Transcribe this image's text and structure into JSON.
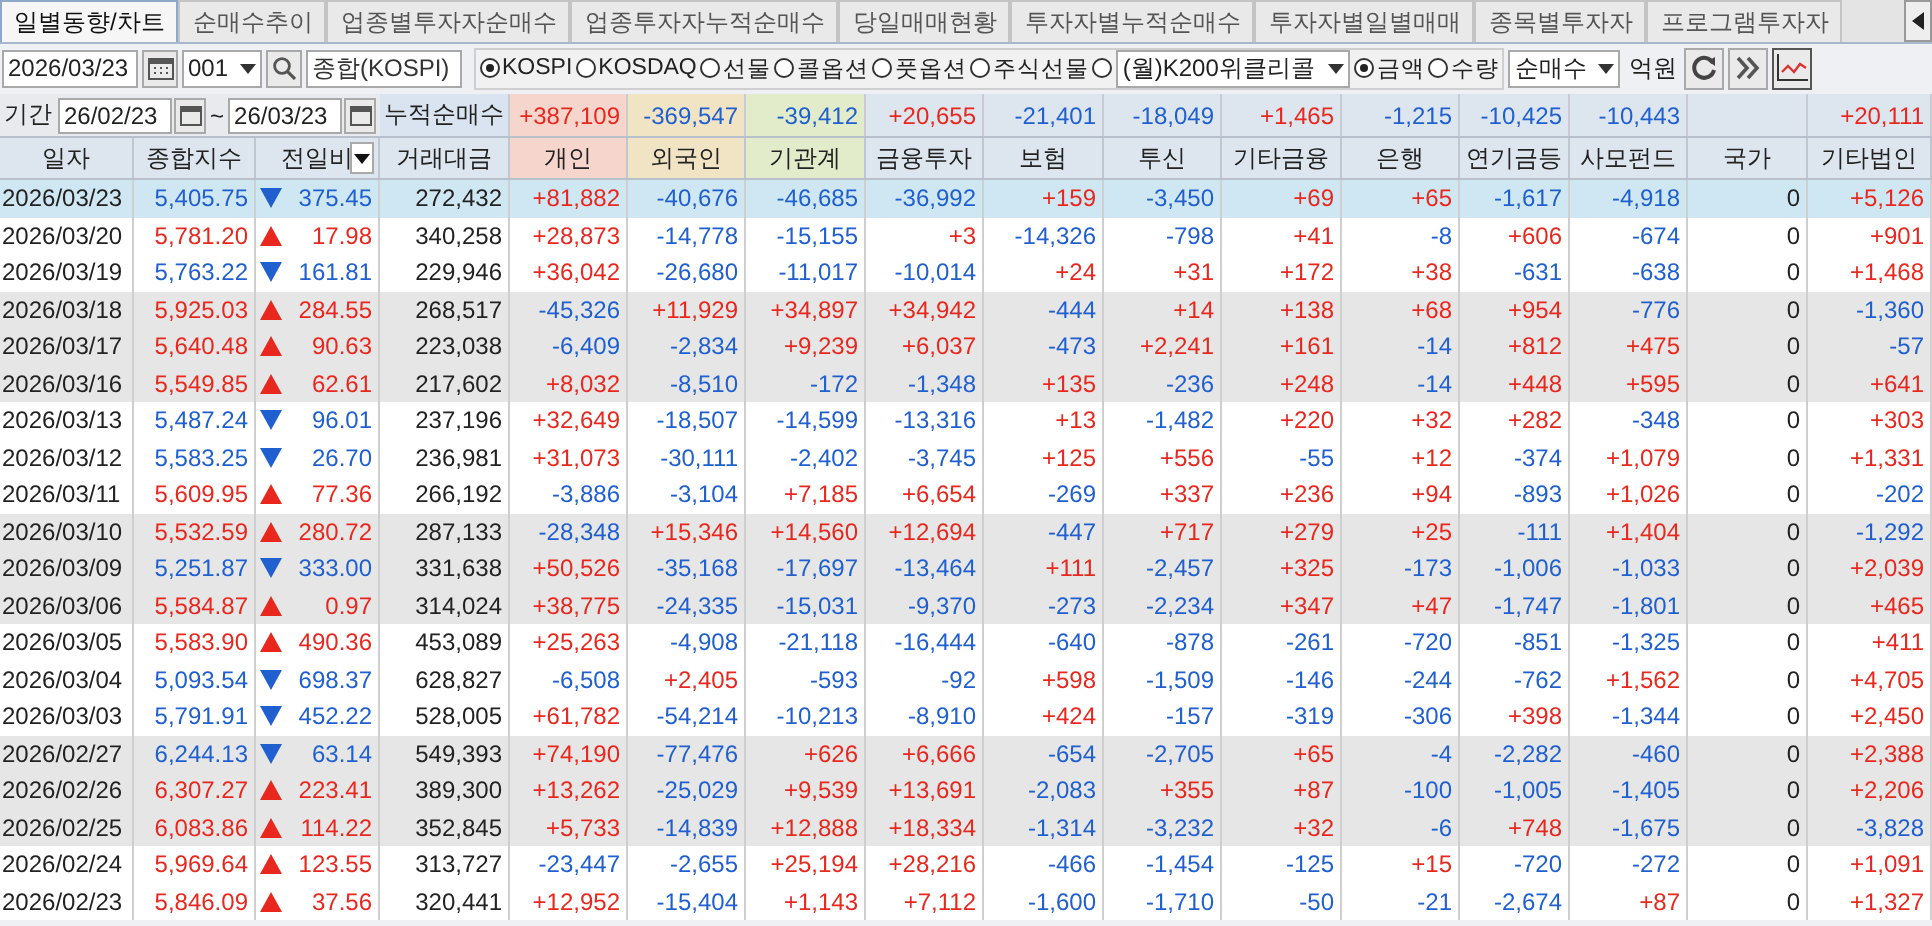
{
  "tabs": [
    {
      "label": "일별동향/차트",
      "selected": true
    },
    {
      "label": "순매수추이",
      "selected": false
    },
    {
      "label": "업종별투자자순매수",
      "selected": false
    },
    {
      "label": "업종투자자누적순매수",
      "selected": false
    },
    {
      "label": "당일매매현황",
      "selected": false
    },
    {
      "label": "투자자별누적순매수",
      "selected": false
    },
    {
      "label": "투자자별일별매매",
      "selected": false
    },
    {
      "label": "종목별투자자",
      "selected": false
    },
    {
      "label": "프로그램투자자",
      "selected": false
    }
  ],
  "toolbar": {
    "date": "2026/03/23",
    "code": "001",
    "market_name": "종합(KOSPI)",
    "markets": [
      {
        "label": "KOSPI",
        "selected": true
      },
      {
        "label": "KOSDAQ",
        "selected": false
      },
      {
        "label": "선물",
        "selected": false
      },
      {
        "label": "콜옵션",
        "selected": false
      },
      {
        "label": "풋옵션",
        "selected": false
      },
      {
        "label": "주식선물",
        "selected": false
      }
    ],
    "weekly_option": {
      "selected": false,
      "value": "(월)K200위클리콜"
    },
    "units": [
      {
        "label": "금액",
        "selected": true
      },
      {
        "label": "수량",
        "selected": false
      }
    ],
    "trade_type": "순매수",
    "unit_label": "억원"
  },
  "period": {
    "label": "기간",
    "from": "26/02/23",
    "separator": "~",
    "to": "26/03/23",
    "summary_label": "누적순매수"
  },
  "columns": [
    {
      "label": "일자",
      "color": "#dde5ee"
    },
    {
      "label": "종합지수",
      "color": "#dde5ee"
    },
    {
      "label": "전일비",
      "color": "#dde5ee",
      "menu": true
    },
    {
      "label": "거래대금",
      "color": "#dde5ee"
    },
    {
      "label": "개인",
      "color": "#f6d6cc",
      "total": "+387,109"
    },
    {
      "label": "외국인",
      "color": "#f1e4c4",
      "total": "-369,547"
    },
    {
      "label": "기관계",
      "color": "#e2ecca",
      "total": "-39,412"
    },
    {
      "label": "금융투자",
      "color": "#dde5ee",
      "total": "+20,655"
    },
    {
      "label": "보험",
      "color": "#dde5ee",
      "total": "-21,401"
    },
    {
      "label": "투신",
      "color": "#dde5ee",
      "total": "-18,049"
    },
    {
      "label": "기타금융",
      "color": "#dde5ee",
      "total": "+1,465"
    },
    {
      "label": "은행",
      "color": "#dde5ee",
      "total": "-1,215"
    },
    {
      "label": "연기금등",
      "color": "#dde5ee",
      "total": "-10,425"
    },
    {
      "label": "사모펀드",
      "color": "#dde5ee",
      "total": "-10,443"
    },
    {
      "label": "국가",
      "color": "#dde5ee"
    },
    {
      "label": "기타법인",
      "color": "#dde5ee",
      "total": "+20,111"
    }
  ],
  "rows": [
    {
      "date": "2026/03/23",
      "index": "5,405.75",
      "rising": false,
      "change": "375.45",
      "volume": "272,432",
      "values": [
        "+81,882",
        "-40,676",
        "-46,685",
        "-36,992",
        "+159",
        "-3,450",
        "+69",
        "+65",
        "-1,617",
        "-4,918",
        "0",
        "+5,126"
      ],
      "selected": true,
      "shaded": false
    },
    {
      "date": "2026/03/20",
      "index": "5,781.20",
      "rising": true,
      "change": "17.98",
      "volume": "340,258",
      "values": [
        "+28,873",
        "-14,778",
        "-15,155",
        "+3",
        "-14,326",
        "-798",
        "+41",
        "-8",
        "+606",
        "-674",
        "0",
        "+901"
      ],
      "selected": false,
      "shaded": false
    },
    {
      "date": "2026/03/19",
      "index": "5,763.22",
      "rising": false,
      "change": "161.81",
      "volume": "229,946",
      "values": [
        "+36,042",
        "-26,680",
        "-11,017",
        "-10,014",
        "+24",
        "+31",
        "+172",
        "+38",
        "-631",
        "-638",
        "0",
        "+1,468"
      ],
      "selected": false,
      "shaded": false
    },
    {
      "date": "2026/03/18",
      "index": "5,925.03",
      "rising": true,
      "change": "284.55",
      "volume": "268,517",
      "values": [
        "-45,326",
        "+11,929",
        "+34,897",
        "+34,942",
        "-444",
        "+14",
        "+138",
        "+68",
        "+954",
        "-776",
        "0",
        "-1,360"
      ],
      "selected": false,
      "shaded": true
    },
    {
      "date": "2026/03/17",
      "index": "5,640.48",
      "rising": true,
      "change": "90.63",
      "volume": "223,038",
      "values": [
        "-6,409",
        "-2,834",
        "+9,239",
        "+6,037",
        "-473",
        "+2,241",
        "+161",
        "-14",
        "+812",
        "+475",
        "0",
        "-57"
      ],
      "selected": false,
      "shaded": true
    },
    {
      "date": "2026/03/16",
      "index": "5,549.85",
      "rising": true,
      "change": "62.61",
      "volume": "217,602",
      "values": [
        "+8,032",
        "-8,510",
        "-172",
        "-1,348",
        "+135",
        "-236",
        "+248",
        "-14",
        "+448",
        "+595",
        "0",
        "+641"
      ],
      "selected": false,
      "shaded": true
    },
    {
      "date": "2026/03/13",
      "index": "5,487.24",
      "rising": false,
      "change": "96.01",
      "volume": "237,196",
      "values": [
        "+32,649",
        "-18,507",
        "-14,599",
        "-13,316",
        "+13",
        "-1,482",
        "+220",
        "+32",
        "+282",
        "-348",
        "0",
        "+303"
      ],
      "selected": false,
      "shaded": false
    },
    {
      "date": "2026/03/12",
      "index": "5,583.25",
      "rising": false,
      "change": "26.70",
      "volume": "236,981",
      "values": [
        "+31,073",
        "-30,111",
        "-2,402",
        "-3,745",
        "+125",
        "+556",
        "-55",
        "+12",
        "-374",
        "+1,079",
        "0",
        "+1,331"
      ],
      "selected": false,
      "shaded": false
    },
    {
      "date": "2026/03/11",
      "index": "5,609.95",
      "rising": true,
      "change": "77.36",
      "volume": "266,192",
      "values": [
        "-3,886",
        "-3,104",
        "+7,185",
        "+6,654",
        "-269",
        "+337",
        "+236",
        "+94",
        "-893",
        "+1,026",
        "0",
        "-202"
      ],
      "selected": false,
      "shaded": false
    },
    {
      "date": "2026/03/10",
      "index": "5,532.59",
      "rising": true,
      "change": "280.72",
      "volume": "287,133",
      "values": [
        "-28,348",
        "+15,346",
        "+14,560",
        "+12,694",
        "-447",
        "+717",
        "+279",
        "+25",
        "-111",
        "+1,404",
        "0",
        "-1,292"
      ],
      "selected": false,
      "shaded": true
    },
    {
      "date": "2026/03/09",
      "index": "5,251.87",
      "rising": false,
      "change": "333.00",
      "volume": "331,638",
      "values": [
        "+50,526",
        "-35,168",
        "-17,697",
        "-13,464",
        "+111",
        "-2,457",
        "+325",
        "-173",
        "-1,006",
        "-1,033",
        "0",
        "+2,039"
      ],
      "selected": false,
      "shaded": true
    },
    {
      "date": "2026/03/06",
      "index": "5,584.87",
      "rising": true,
      "change": "0.97",
      "volume": "314,024",
      "values": [
        "+38,775",
        "-24,335",
        "-15,031",
        "-9,370",
        "-273",
        "-2,234",
        "+347",
        "+47",
        "-1,747",
        "-1,801",
        "0",
        "+465"
      ],
      "selected": false,
      "shaded": true
    },
    {
      "date": "2026/03/05",
      "index": "5,583.90",
      "rising": true,
      "change": "490.36",
      "volume": "453,089",
      "values": [
        "+25,263",
        "-4,908",
        "-21,118",
        "-16,444",
        "-640",
        "-878",
        "-261",
        "-720",
        "-851",
        "-1,325",
        "0",
        "+411"
      ],
      "selected": false,
      "shaded": false
    },
    {
      "date": "2026/03/04",
      "index": "5,093.54",
      "rising": false,
      "change": "698.37",
      "volume": "628,827",
      "values": [
        "-6,508",
        "+2,405",
        "-593",
        "-92",
        "+598",
        "-1,509",
        "-146",
        "-244",
        "-762",
        "+1,562",
        "0",
        "+4,705"
      ],
      "selected": false,
      "shaded": false
    },
    {
      "date": "2026/03/03",
      "index": "5,791.91",
      "rising": false,
      "change": "452.22",
      "volume": "528,005",
      "values": [
        "+61,782",
        "-54,214",
        "-10,213",
        "-8,910",
        "+424",
        "-157",
        "-319",
        "-306",
        "+398",
        "-1,344",
        "0",
        "+2,450"
      ],
      "selected": false,
      "shaded": false
    },
    {
      "date": "2026/02/27",
      "index": "6,244.13",
      "rising": false,
      "change": "63.14",
      "volume": "549,393",
      "values": [
        "+74,190",
        "-77,476",
        "+626",
        "+6,666",
        "-654",
        "-2,705",
        "+65",
        "-4",
        "-2,282",
        "-460",
        "0",
        "+2,388"
      ],
      "selected": false,
      "shaded": true
    },
    {
      "date": "2026/02/26",
      "index": "6,307.27",
      "rising": true,
      "change": "223.41",
      "volume": "389,300",
      "values": [
        "+13,262",
        "-25,029",
        "+9,539",
        "+13,691",
        "-2,083",
        "+355",
        "+87",
        "-100",
        "-1,005",
        "-1,405",
        "0",
        "+2,206"
      ],
      "selected": false,
      "shaded": true
    },
    {
      "date": "2026/02/25",
      "index": "6,083.86",
      "rising": true,
      "change": "114.22",
      "volume": "352,845",
      "values": [
        "+5,733",
        "-14,839",
        "+12,888",
        "+18,334",
        "-1,314",
        "-3,232",
        "+32",
        "-6",
        "+748",
        "-1,675",
        "0",
        "-3,828"
      ],
      "selected": false,
      "shaded": true
    },
    {
      "date": "2026/02/24",
      "index": "5,969.64",
      "rising": true,
      "change": "123.55",
      "volume": "313,727",
      "values": [
        "-23,447",
        "-2,655",
        "+25,194",
        "+28,216",
        "-466",
        "-1,454",
        "-125",
        "+15",
        "-720",
        "-272",
        "0",
        "+1,091"
      ],
      "selected": false,
      "shaded": false
    },
    {
      "date": "2026/02/23",
      "index": "5,846.09",
      "rising": true,
      "change": "37.56",
      "volume": "320,441",
      "values": [
        "+12,952",
        "-15,404",
        "+1,143",
        "+7,112",
        "-1,600",
        "-1,710",
        "-50",
        "-21",
        "-2,674",
        "+87",
        "0",
        "+1,327"
      ],
      "selected": false,
      "shaded": false
    }
  ]
}
